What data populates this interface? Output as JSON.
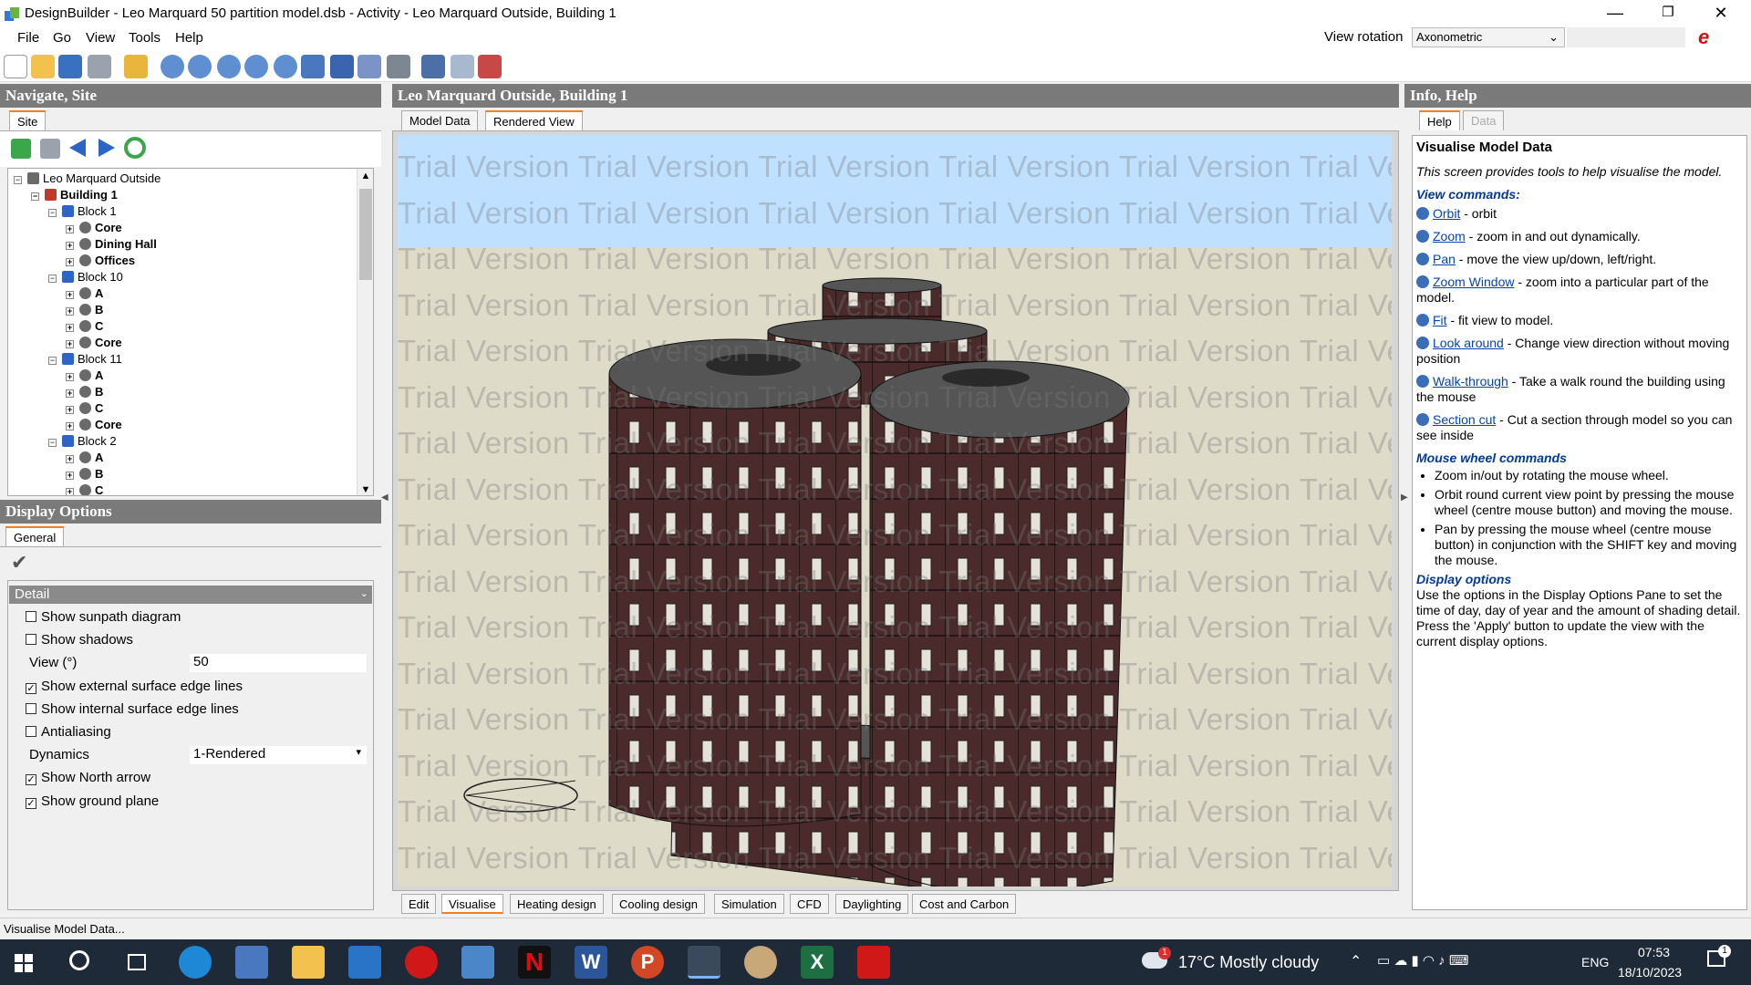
{
  "window": {
    "title": "DesignBuilder - Leo Marquard 50 partition model.dsb - Activity - Leo Marquard Outside, Building 1",
    "minimize": "—",
    "maximize": "❐",
    "close": "✕"
  },
  "menu": [
    "File",
    "Go",
    "View",
    "Tools",
    "Help"
  ],
  "view_rotation": {
    "label": "View rotation",
    "value": "Axonometric"
  },
  "brand": "e",
  "toolbar_icons": [
    "new-icon",
    "open-icon",
    "save-icon",
    "print-icon",
    "wrench-icon",
    "orbit-icon",
    "zoom-icon",
    "pan-icon",
    "zoom-window-icon",
    "fit-icon",
    "look-around-icon",
    "walk-through-icon",
    "section-cut-icon",
    "display-icon",
    "shade-icon",
    "export-icon",
    "report-icon"
  ],
  "navigate": {
    "heading": "Navigate, Site",
    "tab": "Site",
    "tree": [
      {
        "label": "Leo Marquard Outside",
        "level": 0,
        "bold": false,
        "icon": "site",
        "expander": "−"
      },
      {
        "label": "Building 1",
        "level": 1,
        "bold": true,
        "icon": "building",
        "expander": "−"
      },
      {
        "label": "Block 1",
        "level": 2,
        "bold": false,
        "icon": "block",
        "expander": "−"
      },
      {
        "label": "Core",
        "level": 3,
        "bold": true,
        "icon": "zone",
        "expander": "+"
      },
      {
        "label": "Dining Hall",
        "level": 3,
        "bold": true,
        "icon": "zone",
        "expander": "+"
      },
      {
        "label": "Offices",
        "level": 3,
        "bold": true,
        "icon": "zone",
        "expander": "+"
      },
      {
        "label": "Block 10",
        "level": 2,
        "bold": false,
        "icon": "block",
        "expander": "−"
      },
      {
        "label": "A",
        "level": 3,
        "bold": true,
        "icon": "zone",
        "expander": "+"
      },
      {
        "label": "B",
        "level": 3,
        "bold": true,
        "icon": "zone",
        "expander": "+"
      },
      {
        "label": "C",
        "level": 3,
        "bold": true,
        "icon": "zone",
        "expander": "+"
      },
      {
        "label": "Core",
        "level": 3,
        "bold": true,
        "icon": "zone",
        "expander": "+"
      },
      {
        "label": "Block 11",
        "level": 2,
        "bold": false,
        "icon": "block",
        "expander": "−"
      },
      {
        "label": "A",
        "level": 3,
        "bold": true,
        "icon": "zone",
        "expander": "+"
      },
      {
        "label": "B",
        "level": 3,
        "bold": true,
        "icon": "zone",
        "expander": "+"
      },
      {
        "label": "C",
        "level": 3,
        "bold": true,
        "icon": "zone",
        "expander": "+"
      },
      {
        "label": "Core",
        "level": 3,
        "bold": true,
        "icon": "zone",
        "expander": "+"
      },
      {
        "label": "Block 2",
        "level": 2,
        "bold": false,
        "icon": "block",
        "expander": "−"
      },
      {
        "label": "A",
        "level": 3,
        "bold": true,
        "icon": "zone",
        "expander": "+"
      },
      {
        "label": "B",
        "level": 3,
        "bold": true,
        "icon": "zone",
        "expander": "+"
      },
      {
        "label": "C",
        "level": 3,
        "bold": true,
        "icon": "zone",
        "expander": "+"
      }
    ]
  },
  "display_options": {
    "heading": "Display Options",
    "tab": "General",
    "apply": "✔",
    "section": "Detail",
    "options": [
      {
        "label": "Show sunpath diagram",
        "type": "checkbox",
        "checked": false
      },
      {
        "label": "Show shadows",
        "type": "checkbox",
        "checked": false
      },
      {
        "label": "View (°)",
        "type": "value",
        "value": "50"
      },
      {
        "label": "Show external surface edge lines",
        "type": "checkbox",
        "checked": true
      },
      {
        "label": "Show internal surface edge lines",
        "type": "checkbox",
        "checked": false
      },
      {
        "label": "Antialiasing",
        "type": "checkbox",
        "checked": false
      },
      {
        "label": "Dynamics",
        "type": "select",
        "value": "1-Rendered"
      },
      {
        "label": "Show North arrow",
        "type": "checkbox",
        "checked": true
      },
      {
        "label": "Show ground plane",
        "type": "checkbox",
        "checked": true
      }
    ]
  },
  "center": {
    "heading": "Leo Marquard Outside, Building 1",
    "tabs": [
      {
        "label": "Model Data",
        "active": false
      },
      {
        "label": "Rendered View",
        "active": true
      }
    ],
    "watermark": "Trial Version Trial Version Trial Version Trial Version Trial Version Trial Version",
    "bottom_tabs": [
      {
        "label": "Edit",
        "active": false
      },
      {
        "label": "Visualise",
        "active": true
      },
      {
        "label": "Heating design",
        "active": false
      },
      {
        "label": "Cooling design",
        "active": false
      },
      {
        "label": "Simulation",
        "active": false
      },
      {
        "label": "CFD",
        "active": false
      },
      {
        "label": "Daylighting",
        "active": false
      },
      {
        "label": "Cost and Carbon",
        "active": false
      }
    ]
  },
  "info": {
    "heading": "Info, Help",
    "tabs": [
      {
        "label": "Help",
        "active": true
      },
      {
        "label": "Data",
        "active": false
      }
    ],
    "title": "Visualise Model Data",
    "intro": "This screen provides tools to help visualise the model.",
    "view_commands_heading": "View commands:",
    "commands": [
      {
        "link": "Orbit",
        "text": " - orbit"
      },
      {
        "link": "Zoom",
        "text": " - zoom in and out dynamically."
      },
      {
        "link": "Pan",
        "text": " - move the view up/down, left/right."
      },
      {
        "link": "Zoom Window",
        "text": " - zoom into a particular part of the model."
      },
      {
        "link": "Fit",
        "text": " - fit view to model."
      },
      {
        "link": "Look around",
        "text": " - Change view direction without moving position"
      },
      {
        "link": "Walk-through",
        "text": " - Take a walk round the building using the mouse"
      },
      {
        "link": "Section cut",
        "text": " - Cut a section through model so you can see inside"
      }
    ],
    "mouse_heading": "Mouse wheel commands",
    "mouse_items": [
      "Zoom in/out by rotating the mouse wheel.",
      "Orbit round current view point by pressing the mouse wheel (centre mouse button) and moving the mouse.",
      "Pan by pressing the mouse wheel (centre mouse button) in conjunction with the SHIFT key and moving the mouse."
    ],
    "display_heading": "Display options",
    "display_text": "Use the options in the Display Options Pane to set the time of day, day of year and the amount of shading detail.  Press the 'Apply' button to update the view with the current display options."
  },
  "status": "Visualise Model Data...",
  "taskbar": {
    "apps": [
      "start-icon",
      "search-icon",
      "task-view-icon",
      "edge-icon",
      "store-icon",
      "explorer-icon",
      "mail-icon",
      "opera-icon",
      "calculator-icon",
      "netflix-icon",
      "word-icon",
      "powerpoint-icon",
      "designbuilder-icon",
      "paint-icon",
      "excel-icon",
      "acrobat-icon"
    ],
    "weather": "17°C  Mostly cloudy",
    "lang": "ENG",
    "time": "07:53",
    "date": "18/10/2023",
    "notif_count": "1"
  }
}
